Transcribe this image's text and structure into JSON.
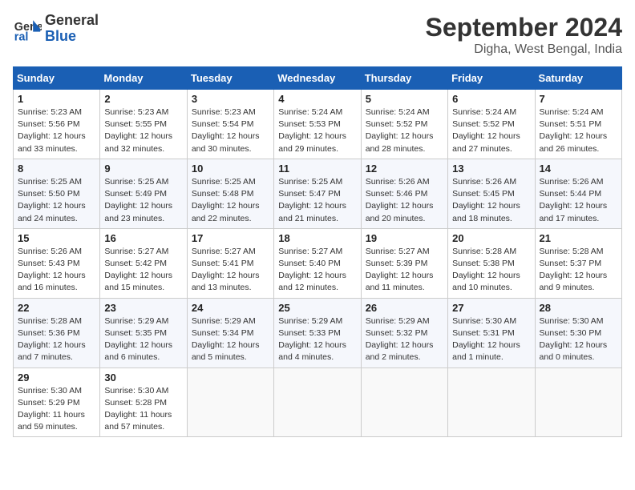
{
  "header": {
    "logo_line1": "General",
    "logo_line2": "Blue",
    "month": "September 2024",
    "location": "Digha, West Bengal, India"
  },
  "weekdays": [
    "Sunday",
    "Monday",
    "Tuesday",
    "Wednesday",
    "Thursday",
    "Friday",
    "Saturday"
  ],
  "weeks": [
    [
      {
        "day": "1",
        "info": "Sunrise: 5:23 AM\nSunset: 5:56 PM\nDaylight: 12 hours\nand 33 minutes."
      },
      {
        "day": "2",
        "info": "Sunrise: 5:23 AM\nSunset: 5:55 PM\nDaylight: 12 hours\nand 32 minutes."
      },
      {
        "day": "3",
        "info": "Sunrise: 5:23 AM\nSunset: 5:54 PM\nDaylight: 12 hours\nand 30 minutes."
      },
      {
        "day": "4",
        "info": "Sunrise: 5:24 AM\nSunset: 5:53 PM\nDaylight: 12 hours\nand 29 minutes."
      },
      {
        "day": "5",
        "info": "Sunrise: 5:24 AM\nSunset: 5:52 PM\nDaylight: 12 hours\nand 28 minutes."
      },
      {
        "day": "6",
        "info": "Sunrise: 5:24 AM\nSunset: 5:52 PM\nDaylight: 12 hours\nand 27 minutes."
      },
      {
        "day": "7",
        "info": "Sunrise: 5:24 AM\nSunset: 5:51 PM\nDaylight: 12 hours\nand 26 minutes."
      }
    ],
    [
      {
        "day": "8",
        "info": "Sunrise: 5:25 AM\nSunset: 5:50 PM\nDaylight: 12 hours\nand 24 minutes."
      },
      {
        "day": "9",
        "info": "Sunrise: 5:25 AM\nSunset: 5:49 PM\nDaylight: 12 hours\nand 23 minutes."
      },
      {
        "day": "10",
        "info": "Sunrise: 5:25 AM\nSunset: 5:48 PM\nDaylight: 12 hours\nand 22 minutes."
      },
      {
        "day": "11",
        "info": "Sunrise: 5:25 AM\nSunset: 5:47 PM\nDaylight: 12 hours\nand 21 minutes."
      },
      {
        "day": "12",
        "info": "Sunrise: 5:26 AM\nSunset: 5:46 PM\nDaylight: 12 hours\nand 20 minutes."
      },
      {
        "day": "13",
        "info": "Sunrise: 5:26 AM\nSunset: 5:45 PM\nDaylight: 12 hours\nand 18 minutes."
      },
      {
        "day": "14",
        "info": "Sunrise: 5:26 AM\nSunset: 5:44 PM\nDaylight: 12 hours\nand 17 minutes."
      }
    ],
    [
      {
        "day": "15",
        "info": "Sunrise: 5:26 AM\nSunset: 5:43 PM\nDaylight: 12 hours\nand 16 minutes."
      },
      {
        "day": "16",
        "info": "Sunrise: 5:27 AM\nSunset: 5:42 PM\nDaylight: 12 hours\nand 15 minutes."
      },
      {
        "day": "17",
        "info": "Sunrise: 5:27 AM\nSunset: 5:41 PM\nDaylight: 12 hours\nand 13 minutes."
      },
      {
        "day": "18",
        "info": "Sunrise: 5:27 AM\nSunset: 5:40 PM\nDaylight: 12 hours\nand 12 minutes."
      },
      {
        "day": "19",
        "info": "Sunrise: 5:27 AM\nSunset: 5:39 PM\nDaylight: 12 hours\nand 11 minutes."
      },
      {
        "day": "20",
        "info": "Sunrise: 5:28 AM\nSunset: 5:38 PM\nDaylight: 12 hours\nand 10 minutes."
      },
      {
        "day": "21",
        "info": "Sunrise: 5:28 AM\nSunset: 5:37 PM\nDaylight: 12 hours\nand 9 minutes."
      }
    ],
    [
      {
        "day": "22",
        "info": "Sunrise: 5:28 AM\nSunset: 5:36 PM\nDaylight: 12 hours\nand 7 minutes."
      },
      {
        "day": "23",
        "info": "Sunrise: 5:29 AM\nSunset: 5:35 PM\nDaylight: 12 hours\nand 6 minutes."
      },
      {
        "day": "24",
        "info": "Sunrise: 5:29 AM\nSunset: 5:34 PM\nDaylight: 12 hours\nand 5 minutes."
      },
      {
        "day": "25",
        "info": "Sunrise: 5:29 AM\nSunset: 5:33 PM\nDaylight: 12 hours\nand 4 minutes."
      },
      {
        "day": "26",
        "info": "Sunrise: 5:29 AM\nSunset: 5:32 PM\nDaylight: 12 hours\nand 2 minutes."
      },
      {
        "day": "27",
        "info": "Sunrise: 5:30 AM\nSunset: 5:31 PM\nDaylight: 12 hours\nand 1 minute."
      },
      {
        "day": "28",
        "info": "Sunrise: 5:30 AM\nSunset: 5:30 PM\nDaylight: 12 hours\nand 0 minutes."
      }
    ],
    [
      {
        "day": "29",
        "info": "Sunrise: 5:30 AM\nSunset: 5:29 PM\nDaylight: 11 hours\nand 59 minutes."
      },
      {
        "day": "30",
        "info": "Sunrise: 5:30 AM\nSunset: 5:28 PM\nDaylight: 11 hours\nand 57 minutes."
      },
      {
        "day": "",
        "info": ""
      },
      {
        "day": "",
        "info": ""
      },
      {
        "day": "",
        "info": ""
      },
      {
        "day": "",
        "info": ""
      },
      {
        "day": "",
        "info": ""
      }
    ]
  ]
}
